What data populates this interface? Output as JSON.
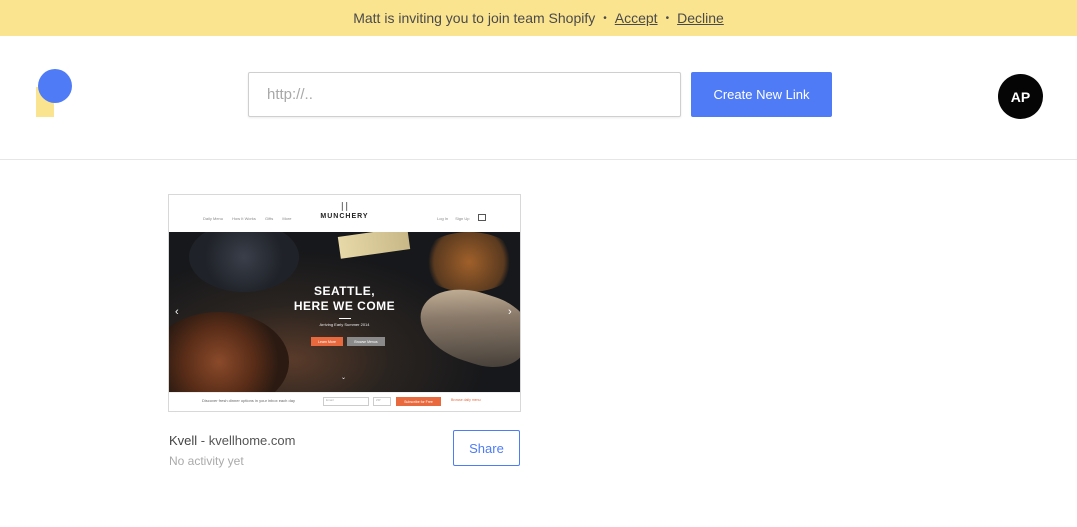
{
  "banner": {
    "message": "Matt is inviting you to join team Shopify",
    "separator": "•",
    "accept_label": "Accept",
    "decline_label": "Decline",
    "background": "#fbe490"
  },
  "header": {
    "url_input": {
      "value": "",
      "placeholder": "http://.."
    },
    "create_button_label": "Create New Link",
    "avatar_initials": "AP",
    "accent_color": "#4f7cf6"
  },
  "links": [
    {
      "name": "Kvell",
      "separator": " - ",
      "domain": "kvellhome.com",
      "activity": "No activity yet",
      "share_label": "Share",
      "thumbnail": {
        "brand": "MUNCHERY",
        "fork_glyph": "🍴",
        "nav_links": [
          "Daily Menu",
          "How It Works",
          "Gifts",
          "More"
        ],
        "nav_right": [
          "Log In",
          "Sign Up"
        ],
        "headline_1": "SEATTLE,",
        "headline_2": "HERE WE COME",
        "subline": "Arriving Early Summer 2014",
        "primary_cta": "Learn More",
        "secondary_cta": "Browse Menus",
        "footer_text": "Discover fresh dinner options in your inbox each day",
        "email_placeholder": "Email",
        "zip_placeholder": "ZIP",
        "subscribe_label": "Subscribe for Free",
        "browse_label": "Browse daily menu",
        "prev_arrow": "‹",
        "next_arrow": "›",
        "scroll_chevron": "⌄"
      }
    }
  ]
}
